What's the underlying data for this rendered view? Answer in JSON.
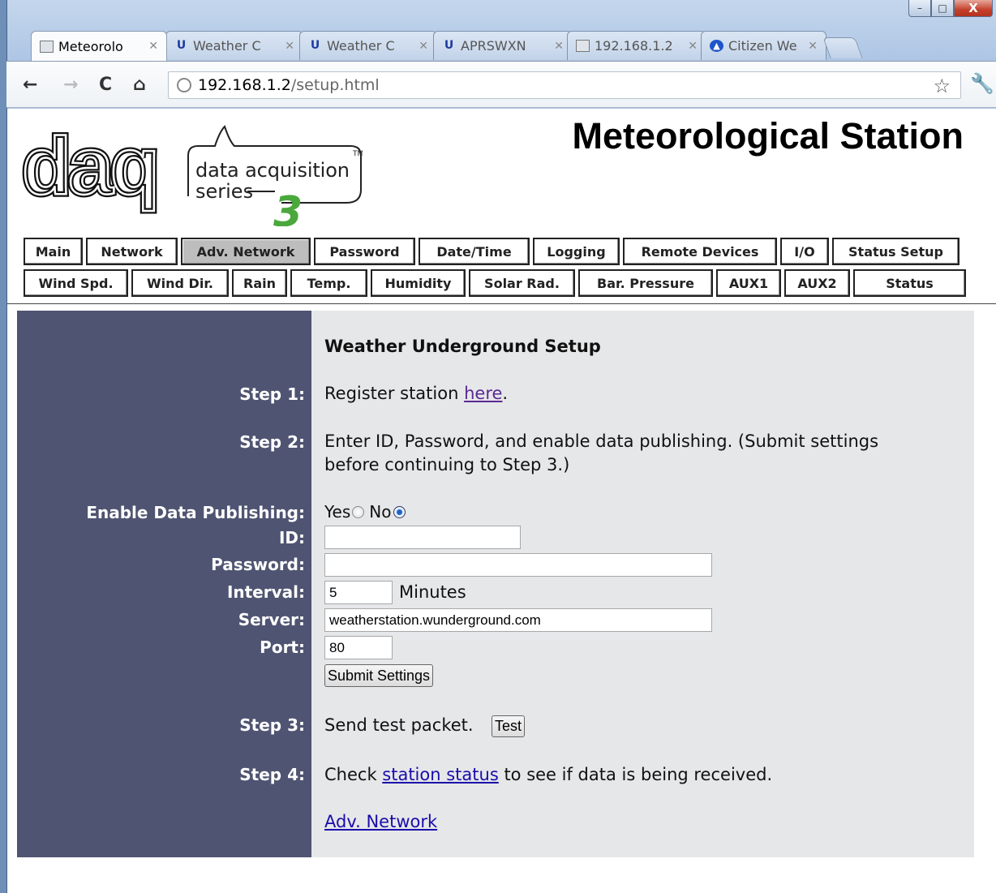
{
  "browser": {
    "tabs": [
      {
        "label": "Meteorolo",
        "icon": "page-icon",
        "active": true
      },
      {
        "label": "Weather C",
        "icon": "wunderground-icon",
        "active": false
      },
      {
        "label": "Weather C",
        "icon": "wunderground-icon",
        "active": false
      },
      {
        "label": "APRSWXN",
        "icon": "wunderground-icon",
        "active": false
      },
      {
        "label": "192.168.1.2",
        "icon": "page-icon",
        "active": false
      },
      {
        "label": "Citizen We",
        "icon": "cwop-icon",
        "active": false
      }
    ],
    "url_host": "192.168.1.2",
    "url_path": "/setup.html",
    "window_controls": {
      "minimize": "–",
      "maximize": "□",
      "close": "X"
    }
  },
  "header": {
    "title": "Meteorological Station",
    "logo_text": "daq",
    "logo_subtitle_1": "data acquisition",
    "logo_subtitle_2": "series",
    "logo_number": "3",
    "logo_tm": "TM"
  },
  "nav": {
    "row1": [
      "Main",
      "Network",
      "Adv. Network",
      "Password",
      "Date/Time",
      "Logging",
      "Remote Devices",
      "I/O",
      "Status Setup"
    ],
    "row2": [
      "Wind Spd.",
      "Wind Dir.",
      "Rain",
      "Temp.",
      "Humidity",
      "Solar Rad.",
      "Bar. Pressure",
      "AUX1",
      "AUX2",
      "Status"
    ],
    "selected": "Adv. Network"
  },
  "form": {
    "heading": "Weather Underground Setup",
    "step1_label": "Step 1:",
    "step1_text": "Register station ",
    "step1_link": "here",
    "step1_end": ".",
    "step2_label": "Step 2:",
    "step2_text_line1": "Enter ID, Password, and enable data publishing. (Submit settings",
    "step2_text_line2": "before continuing to Step 3.)",
    "enable_label": "Enable Data Publishing:",
    "yes_label": "Yes",
    "no_label": "No",
    "publishing_enabled": false,
    "id_label": "ID:",
    "id_value": "",
    "password_label": "Password:",
    "password_value": "",
    "interval_label": "Interval:",
    "interval_value": "5",
    "interval_unit": "Minutes",
    "server_label": "Server:",
    "server_value": "weatherstation.wunderground.com",
    "port_label": "Port:",
    "port_value": "80",
    "submit_label": "Submit Settings",
    "step3_label": "Step 3:",
    "step3_text": "Send test packet.",
    "test_label": "Test",
    "step4_label": "Step 4:",
    "step4_pre": "Check ",
    "step4_link": "station status",
    "step4_post": " to see if data is being received.",
    "back_link": "Adv. Network"
  }
}
